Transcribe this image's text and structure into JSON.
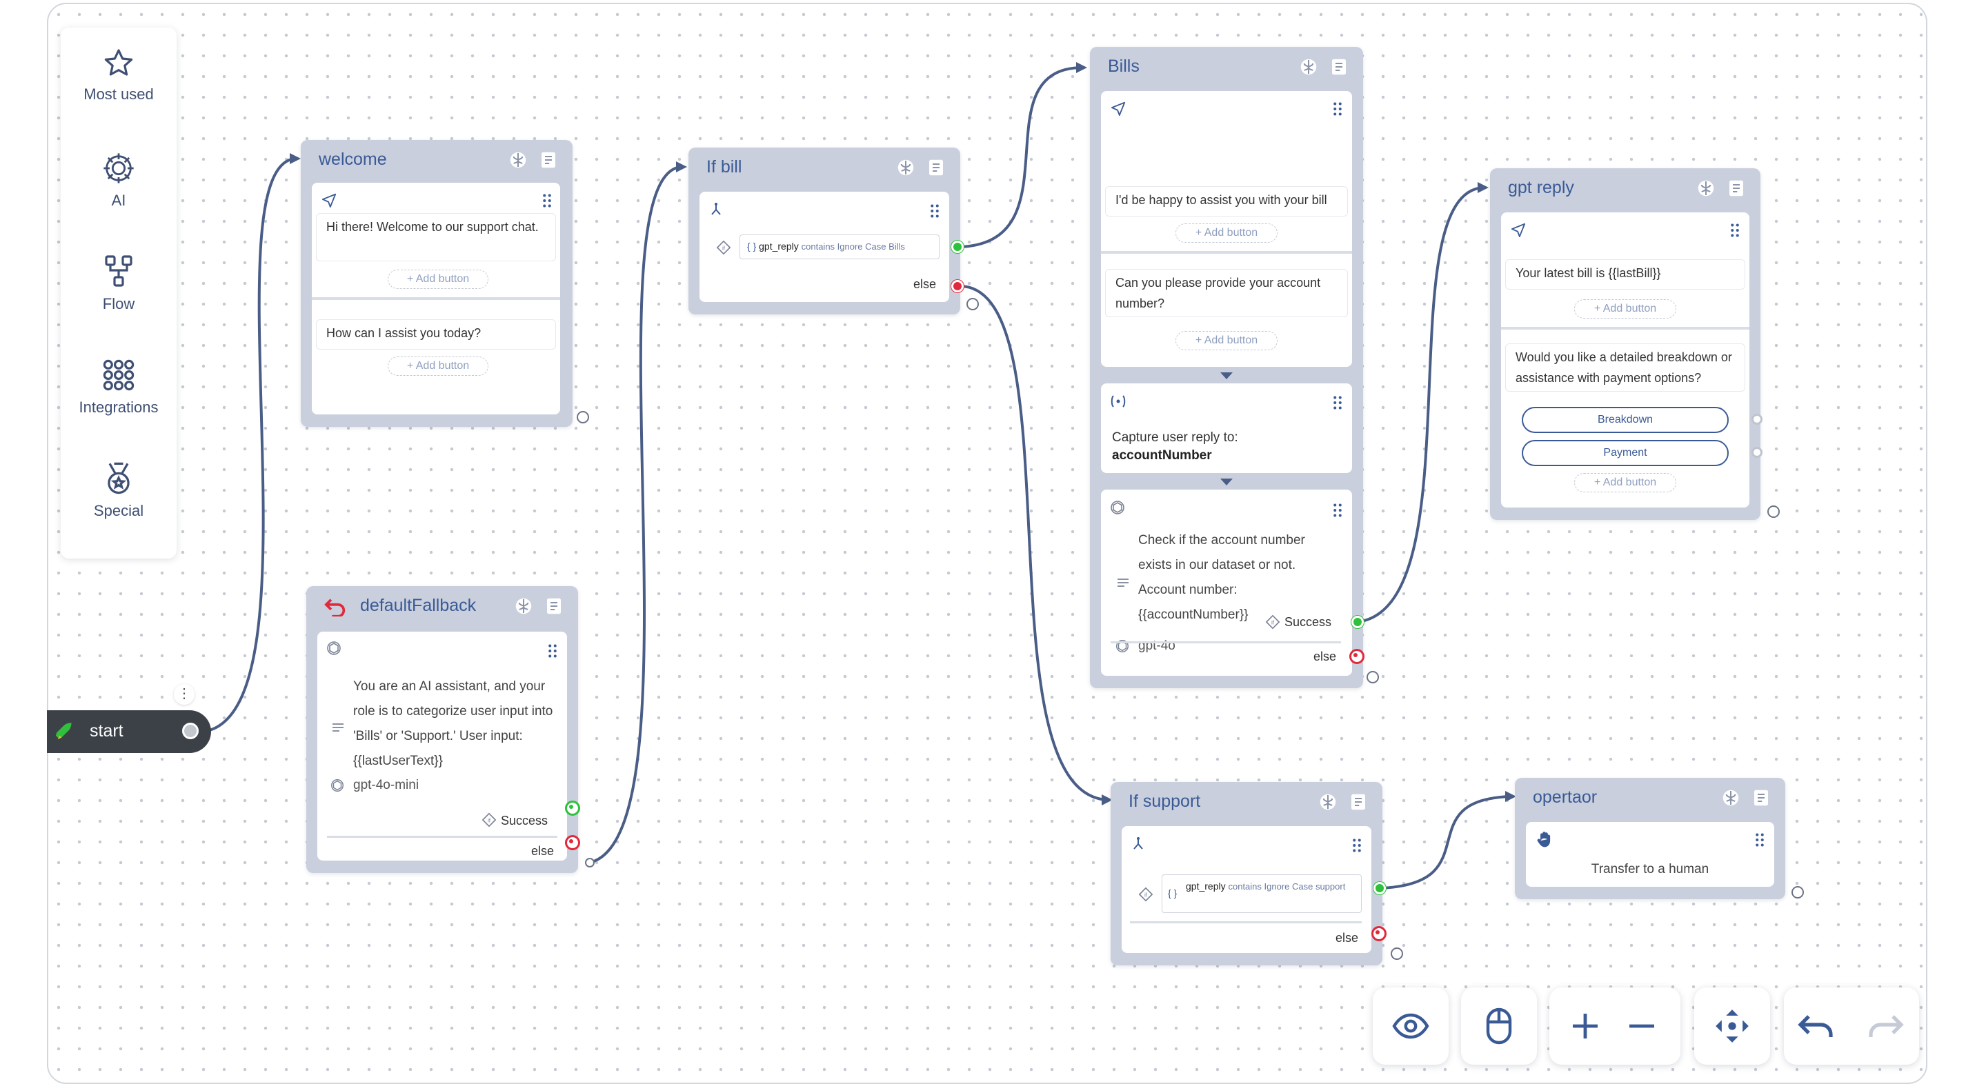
{
  "sidebar": {
    "items": [
      {
        "label": "Most used",
        "icon": "star-icon"
      },
      {
        "label": "AI",
        "icon": "ai-brain-icon"
      },
      {
        "label": "Flow",
        "icon": "flow-icon"
      },
      {
        "label": "Integrations",
        "icon": "integrations-grid-icon"
      },
      {
        "label": "Special",
        "icon": "special-medal-icon"
      }
    ]
  },
  "start": {
    "label": "start"
  },
  "nodes": {
    "welcome": {
      "title": "welcome",
      "messages": [
        "Hi there! Welcome to our support chat.",
        "How can I assist you today?"
      ],
      "add_button": "+ Add button"
    },
    "default_fallback": {
      "title": "defaultFallback",
      "prompt": "You are an AI assistant, and your role is to categorize user input into 'Bills' or 'Support.' User input: {{lastUserText}}",
      "model": "gpt-4o-mini",
      "success": "Success",
      "else": "else"
    },
    "if_bill": {
      "title": "If bill",
      "var": "gpt_reply",
      "rest": "contains Ignore Case Bills",
      "else": "else"
    },
    "bills": {
      "title": "Bills",
      "messages": [
        "I'd be happy to assist you with your bill",
        "Can you please provide your account number?"
      ],
      "add_button": "+ Add button",
      "capture_label": "Capture user reply to:",
      "capture_var": "accountNumber",
      "prompt": "Check if the account number exists in our dataset or not. Account number: {{accountNumber}}",
      "model": "gpt-4o",
      "success": "Success",
      "else": "else"
    },
    "gpt_reply": {
      "title": "gpt reply",
      "messages": [
        "Your latest bill is {{lastBill}}",
        "Would you like a detailed breakdown or assistance with payment options?"
      ],
      "add_button": "+ Add button",
      "choices": [
        "Breakdown",
        "Payment"
      ]
    },
    "if_support": {
      "title": "If support",
      "var": "gpt_reply",
      "rest": "contains Ignore Case support",
      "else": "else"
    },
    "operator": {
      "title": "opertaor",
      "text": "Transfer to a human"
    }
  },
  "controls": [
    "preview-eye",
    "mouse-mode",
    "zoom-in",
    "zoom-out",
    "fit-view",
    "undo",
    "redo"
  ],
  "colors": {
    "accent": "#3a5a96",
    "node_bg": "#c9cfdd",
    "success": "#2fc03c",
    "error": "#e0293a",
    "start_bg": "#3c4148"
  }
}
